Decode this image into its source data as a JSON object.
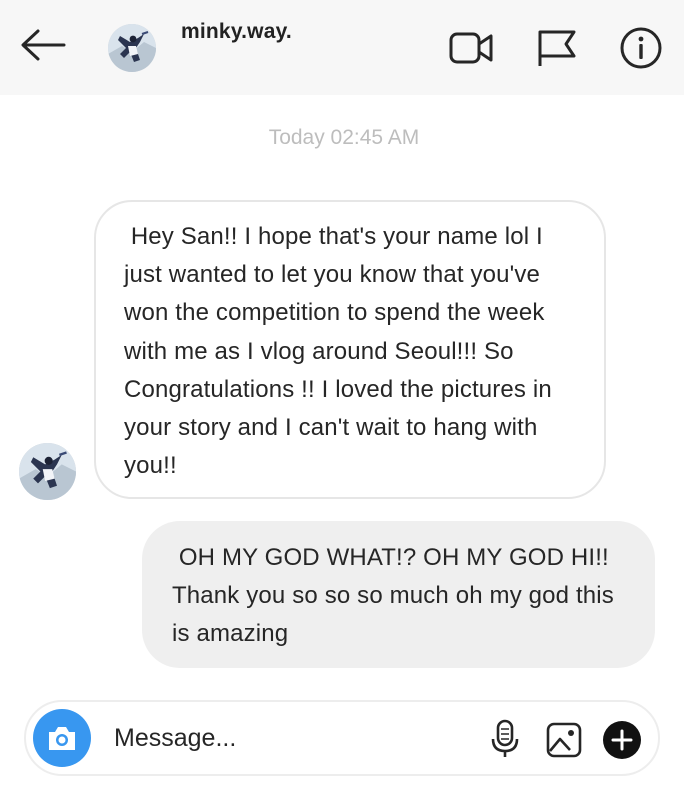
{
  "header": {
    "username": "minky.way.",
    "icons": [
      "back-arrow-icon",
      "video-call-icon",
      "flag-icon",
      "info-icon"
    ]
  },
  "thread": {
    "timestamp": "Today 02:45 AM",
    "messages": [
      {
        "direction": "incoming",
        "text": " Hey San!! I hope that's your name lol I just wanted to let you know that you've won the competition to spend the week with me as I vlog around Seoul!!! So Congratulations !! I loved the pictures in your story and I can't wait to hang with you!!"
      },
      {
        "direction": "outgoing",
        "text": " OH MY GOD WHAT!? OH MY GOD HI!! Thank you so so so much oh my god this is amazing"
      }
    ]
  },
  "composer": {
    "placeholder": "Message...",
    "icons": [
      "camera-icon",
      "microphone-icon",
      "gallery-icon",
      "plus-icon"
    ]
  },
  "colors": {
    "header_bg": "#f7f7f7",
    "outgoing_bubble": "#efefef",
    "camera_button": "#3897f0",
    "timestamp": "#bdbdbd"
  }
}
